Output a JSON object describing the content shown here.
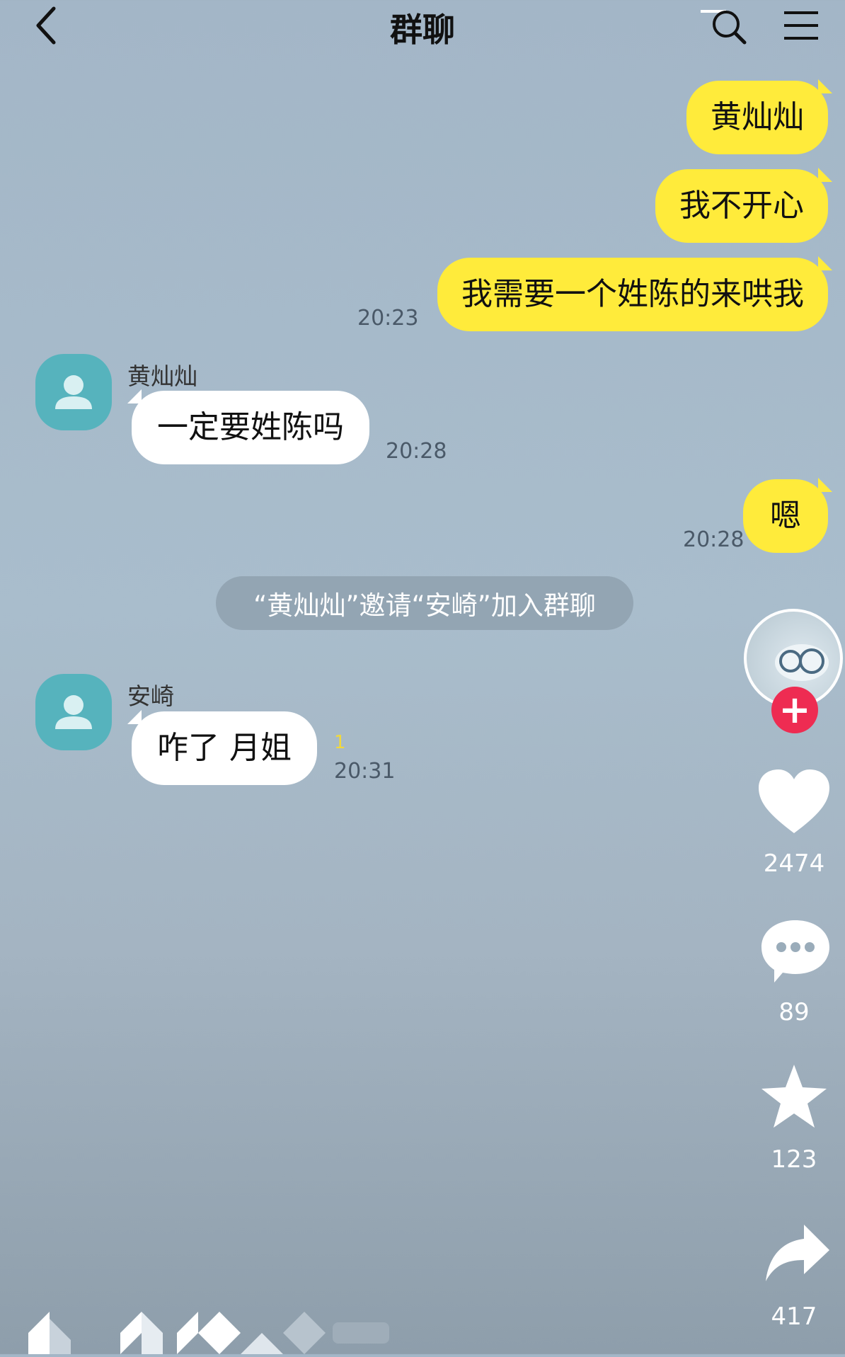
{
  "header": {
    "title": "群聊"
  },
  "messages": [
    {
      "side": "out",
      "text": "黄灿灿"
    },
    {
      "side": "out",
      "text": "我不开心"
    },
    {
      "side": "out",
      "text": "我需要一个姓陈的来哄我",
      "time": "20:23"
    },
    {
      "side": "in",
      "sender": "黄灿灿",
      "text": "一定要姓陈吗",
      "time": "20:28"
    },
    {
      "side": "out",
      "text": "嗯",
      "time": "20:28"
    },
    {
      "side": "in",
      "sender": "安崎",
      "text": "咋了 月姐",
      "unread": "1",
      "time": "20:31"
    }
  ],
  "system_notice": "“黄灿灿”邀请“安崎”加入群聊",
  "rail": {
    "likes": "2474",
    "comments": "89",
    "favorites": "123",
    "shares": "417"
  },
  "colors": {
    "outgoing_bubble": "#ffeb3b",
    "incoming_bubble": "#ffffff",
    "avatar": "#56b3bd",
    "follow": "#ee2c52"
  }
}
